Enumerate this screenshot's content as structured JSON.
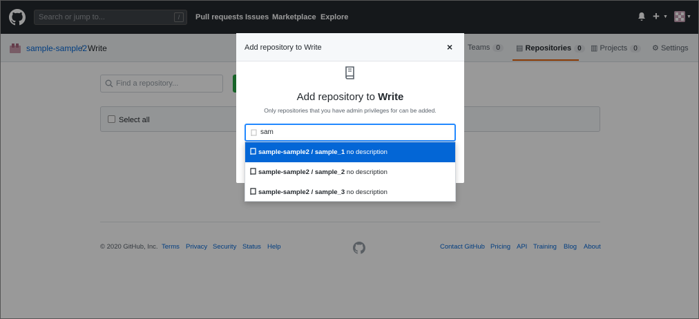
{
  "header": {
    "search_placeholder": "Search or jump to...",
    "search_shortcut": "/",
    "nav": [
      "Pull requests",
      "Issues",
      "Marketplace",
      "Explore"
    ],
    "plus": "+"
  },
  "repo_header": {
    "org": "sample-sample2",
    "separator": "/",
    "team": "Write",
    "tabs": [
      {
        "label": "Teams",
        "count": "0"
      },
      {
        "label": "Repositories",
        "count": "0"
      },
      {
        "label": "Projects",
        "count": "0"
      },
      {
        "label": "Settings"
      }
    ]
  },
  "page": {
    "find_placeholder": "Find a repository...",
    "select_all": "Select all"
  },
  "footer": {
    "copyright": "© 2020 GitHub, Inc.",
    "left_links": [
      "Terms",
      "Privacy",
      "Security",
      "Status",
      "Help"
    ],
    "right_links": [
      "Contact GitHub",
      "Pricing",
      "API",
      "Training",
      "Blog",
      "About"
    ]
  },
  "modal": {
    "title": "Add repository to Write",
    "close": "×",
    "heading_prefix": "Add repository to",
    "heading_team": "Write",
    "subtext": "Only repositories that you have admin privileges for can be added.",
    "input_value": "sam",
    "results": [
      {
        "name": "sample-sample2 / sample_1",
        "desc": "no description"
      },
      {
        "name": "sample-sample2 / sample_2",
        "desc": "no description"
      },
      {
        "name": "sample-sample2 / sample_3",
        "desc": "no description"
      }
    ]
  },
  "colors": {
    "header_bg": "#24292e",
    "accent": "#0366d6",
    "tab_underline": "#e36209",
    "green": "#28a745"
  }
}
